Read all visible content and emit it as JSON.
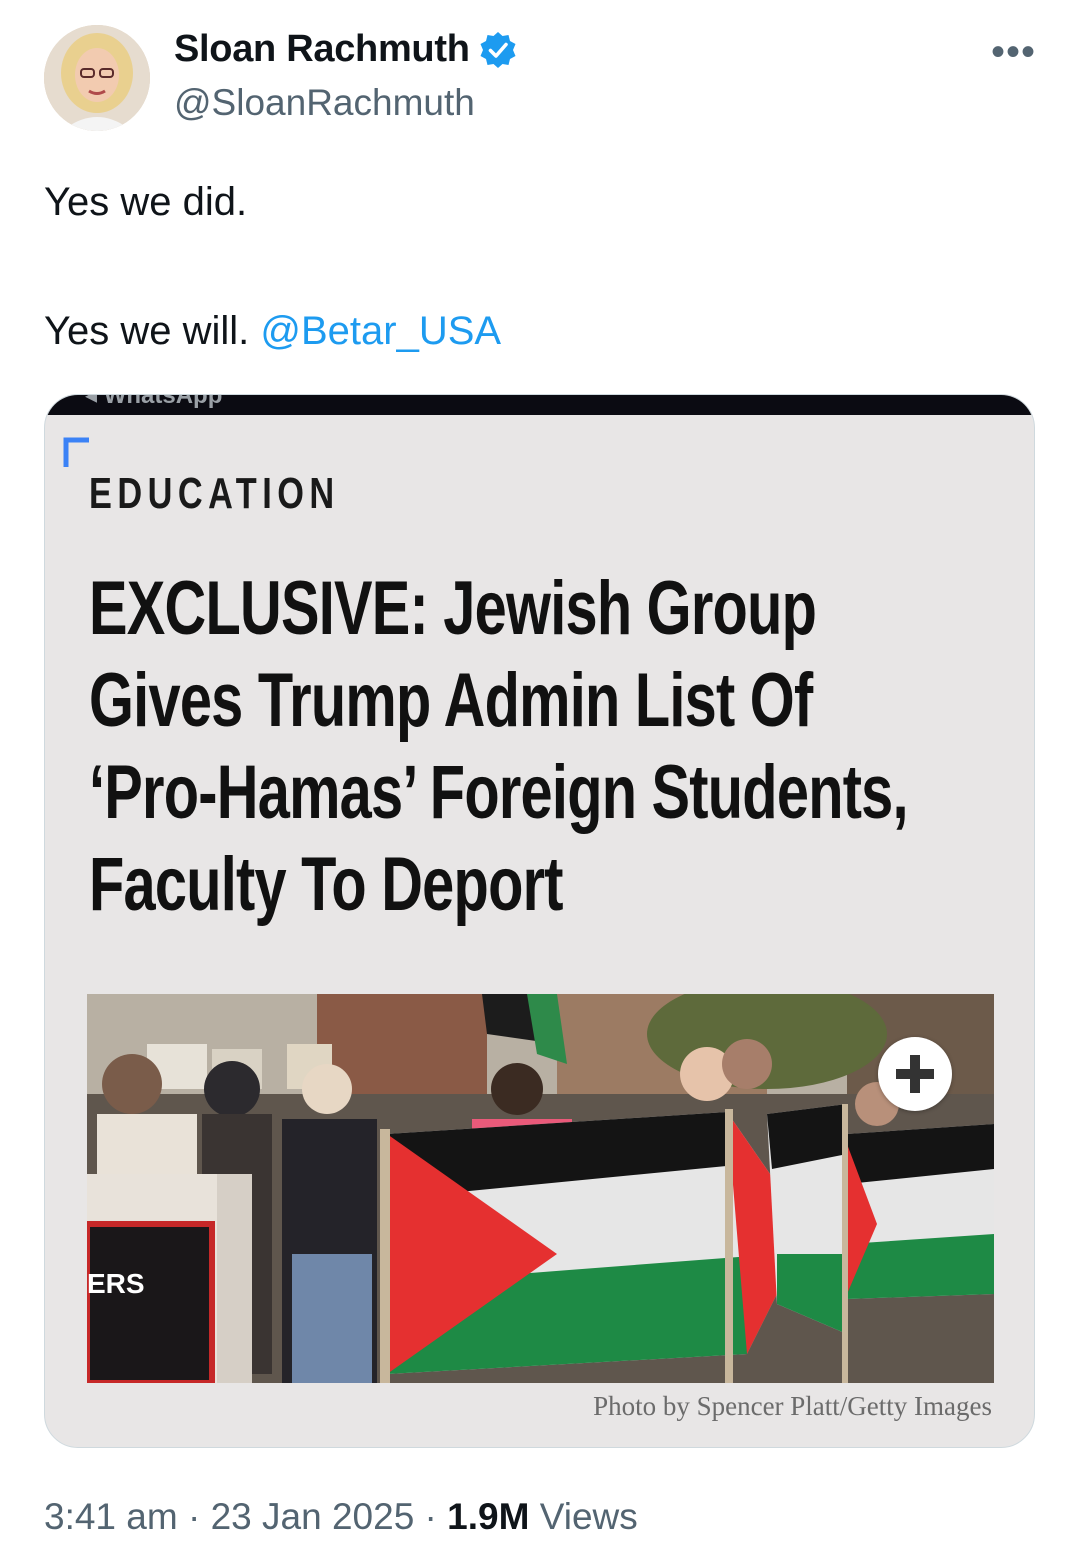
{
  "author": {
    "display_name": "Sloan Rachmuth",
    "handle": "@SloanRachmuth"
  },
  "more_icon": "•••",
  "tweet": {
    "line1": "Yes we did.",
    "line2_text": "Yes we will. ",
    "mention": "@Betar_USA"
  },
  "card": {
    "topbar_text": "◂ WhatsApp",
    "category": "EDUCATION",
    "headline_lines": [
      "EXCLUSIVE: Jewish Group",
      "Gives Trump Admin List Of",
      "‘Pro-Hamas’ Foreign Students,",
      "Faculty To Deport"
    ],
    "banner_text": "ERS",
    "photo_credit": "Photo by Spencer Platt/Getty Images"
  },
  "meta": {
    "time": "3:41 am",
    "sep1": " · ",
    "date": "23 Jan 2025",
    "sep2": " · ",
    "views_count": "1.9M",
    "views_label": " Views"
  },
  "colors": {
    "accent": "#1d9bf0",
    "muted": "#536471",
    "card_bg": "#e8e6e6"
  },
  "icons": {
    "verified": "verified-badge-icon",
    "more": "more-options-icon",
    "expand": "plus-icon"
  }
}
